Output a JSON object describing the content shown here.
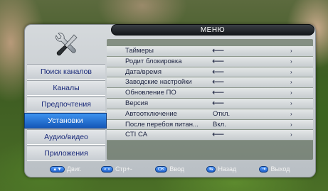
{
  "menu": {
    "title": "МЕНЮ"
  },
  "sidebar": {
    "items": [
      {
        "label": "Поиск каналов",
        "active": false
      },
      {
        "label": "Каналы",
        "active": false
      },
      {
        "label": "Предпочтения",
        "active": false
      },
      {
        "label": "Установки",
        "active": true
      },
      {
        "label": "Аудио/видео",
        "active": false
      },
      {
        "label": "Приложения",
        "active": false
      }
    ]
  },
  "settings": {
    "rows": [
      {
        "label": "Таймеры",
        "value": "⟵",
        "type": "enter"
      },
      {
        "label": "Родит блокировка",
        "value": "⟵",
        "type": "enter"
      },
      {
        "label": "Дата/время",
        "value": "⟵",
        "type": "enter"
      },
      {
        "label": "Заводские настройки",
        "value": "⟵",
        "type": "enter"
      },
      {
        "label": "Обновление ПО",
        "value": "⟵",
        "type": "enter"
      },
      {
        "label": "Версия",
        "value": "⟵",
        "type": "enter"
      },
      {
        "label": "Автоотключение",
        "value": "Откл.",
        "type": "option"
      },
      {
        "label": "После перебоя питан...",
        "value": "Вкл.",
        "type": "option"
      },
      {
        "label": "CTI CA",
        "value": "⟵",
        "type": "enter"
      }
    ],
    "chevron": "›"
  },
  "footer": {
    "move": {
      "key": "▲▼",
      "label": "Двиг."
    },
    "page": {
      "key": "«  »",
      "label": "Стр+-"
    },
    "ok": {
      "key": "OK",
      "label": "Ввод"
    },
    "back": {
      "key": "⇆",
      "label": "Назад"
    },
    "exit": {
      "key": "⇥",
      "label": "Выход"
    }
  },
  "colors": {
    "accent": "#1f6fd6",
    "text": "#1c2340",
    "sidebar_text": "#1a2a7a"
  },
  "icons": {
    "logo": "wrench-screwdriver-icon"
  }
}
